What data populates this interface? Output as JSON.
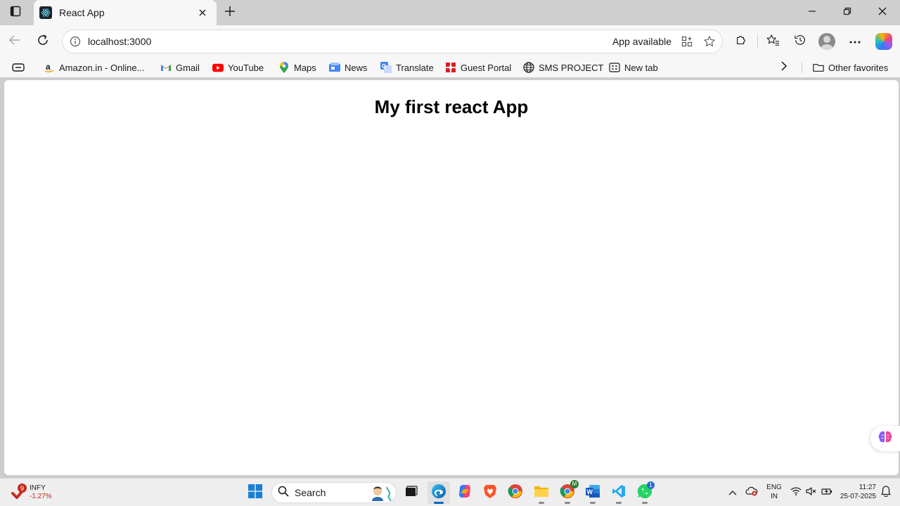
{
  "browser": {
    "tab": {
      "title": "React App"
    },
    "address": {
      "url": "localhost:3000",
      "app_available": "App available"
    }
  },
  "favorites": {
    "items": [
      {
        "label": "Amazon.in - Online..."
      },
      {
        "label": "Gmail"
      },
      {
        "label": "YouTube"
      },
      {
        "label": "Maps"
      },
      {
        "label": "News"
      },
      {
        "label": "Translate"
      },
      {
        "label": "Guest Portal"
      },
      {
        "label": "SMS PROJECT"
      },
      {
        "label": "New tab"
      }
    ],
    "other": "Other favorites"
  },
  "page": {
    "heading": "My first react App"
  },
  "taskbar": {
    "stock": {
      "symbol": "INFY",
      "change": "-1.27%",
      "badge": "9"
    },
    "search_label": "Search",
    "lang_line1": "ENG",
    "lang_line2": "IN",
    "time": "11:27",
    "date": "25-07-2025",
    "whatsapp_badge": "1",
    "chrome_badge": "M"
  },
  "colors": {
    "accent": "#0067c0",
    "react": "#61dafb",
    "youtube": "#ff0000",
    "stock_down": "#c42b1c"
  }
}
